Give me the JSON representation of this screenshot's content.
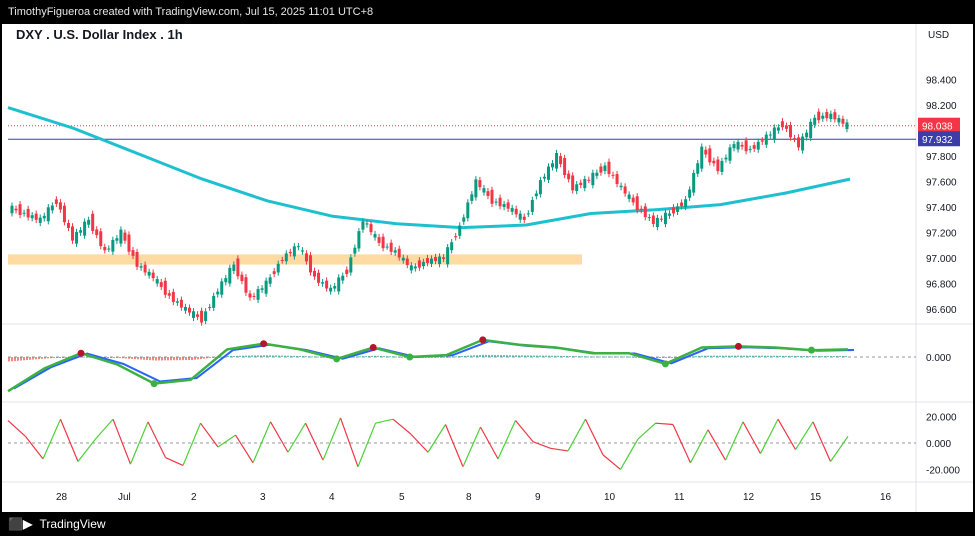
{
  "header": {
    "attribution": "TimothyFigueroa created with TradingView.com, Jul 15, 2025 11:01 UTC+8"
  },
  "footer": {
    "brand": "TradingView",
    "logo": "tradingview-logo"
  },
  "chart_data": {
    "type": "candlestick",
    "title": "DXY . U.S. Dollar Index . 1h",
    "currency": "USD",
    "price_ticks": [
      "98.400",
      "98.200",
      "98.000",
      "97.800",
      "97.600",
      "97.400",
      "97.200",
      "97.000",
      "96.800",
      "96.600"
    ],
    "price_tick_values": [
      98.4,
      98.2,
      98.0,
      97.8,
      97.6,
      97.4,
      97.2,
      97.0,
      96.8,
      96.6
    ],
    "ylim": [
      96.5,
      98.6
    ],
    "x_labels": [
      "28",
      "Jul",
      "2",
      "3",
      "4",
      "5",
      "8",
      "9",
      "10",
      "11",
      "12",
      "15",
      "16"
    ],
    "last_price": {
      "label": "98.038",
      "value": 98.038,
      "color": "#f23645"
    },
    "level_line": {
      "label": "97.932",
      "value": 97.932,
      "color": "#3c3da8"
    },
    "support_zone": {
      "low": 96.95,
      "high": 97.03,
      "color": "#ffd79a"
    },
    "price_path": [
      97.4,
      97.35,
      97.3,
      97.45,
      97.15,
      97.3,
      97.05,
      97.2,
      96.95,
      96.85,
      96.7,
      96.6,
      96.52,
      96.75,
      96.95,
      96.68,
      96.8,
      97.0,
      97.1,
      96.85,
      96.75,
      96.9,
      97.3,
      97.12,
      97.05,
      96.92,
      96.98,
      97.0,
      97.25,
      97.6,
      97.45,
      97.4,
      97.3,
      97.6,
      97.8,
      97.55,
      97.62,
      97.72,
      97.55,
      97.4,
      97.28,
      97.35,
      97.45,
      97.85,
      97.7,
      97.9,
      97.85,
      97.95,
      98.05,
      97.88,
      98.1,
      98.12,
      98.04
    ],
    "ma_line": {
      "color": "#1ec0d0",
      "values": [
        98.18,
        98.02,
        97.82,
        97.62,
        97.45,
        97.33,
        97.27,
        97.24,
        97.26,
        97.35,
        97.38,
        97.42,
        97.51,
        97.62
      ]
    },
    "oscillator": {
      "ticks": [
        "0.000"
      ],
      "fast_color": "#3cb043",
      "slow_color": "#2962ff",
      "bear_color": "#b2182b",
      "values": [
        -0.9,
        -0.3,
        0.1,
        -0.2,
        -0.7,
        -0.6,
        0.2,
        0.35,
        0.2,
        -0.05,
        0.25,
        0.0,
        0.05,
        0.45,
        0.32,
        0.25,
        0.1,
        0.1,
        -0.18,
        0.25,
        0.28,
        0.25,
        0.18,
        0.2
      ]
    },
    "rsi_panel": {
      "ticks": [
        "20.000",
        "0.000",
        "-20.000"
      ],
      "tick_values": [
        20,
        0,
        -20
      ],
      "ylim": [
        -28,
        28
      ],
      "values": [
        17,
        5,
        -12,
        18,
        -14,
        3,
        18,
        -16,
        16,
        -11,
        -17,
        15,
        -3,
        6,
        -15,
        16,
        -7,
        15,
        -13,
        19,
        -18,
        15,
        18,
        7,
        -7,
        14,
        -18,
        12,
        -12,
        17,
        1,
        -4,
        -6,
        18,
        -9,
        -20,
        3,
        15,
        14,
        -15,
        10,
        -13,
        16,
        -8,
        18,
        -5,
        16,
        -14,
        5
      ]
    }
  }
}
